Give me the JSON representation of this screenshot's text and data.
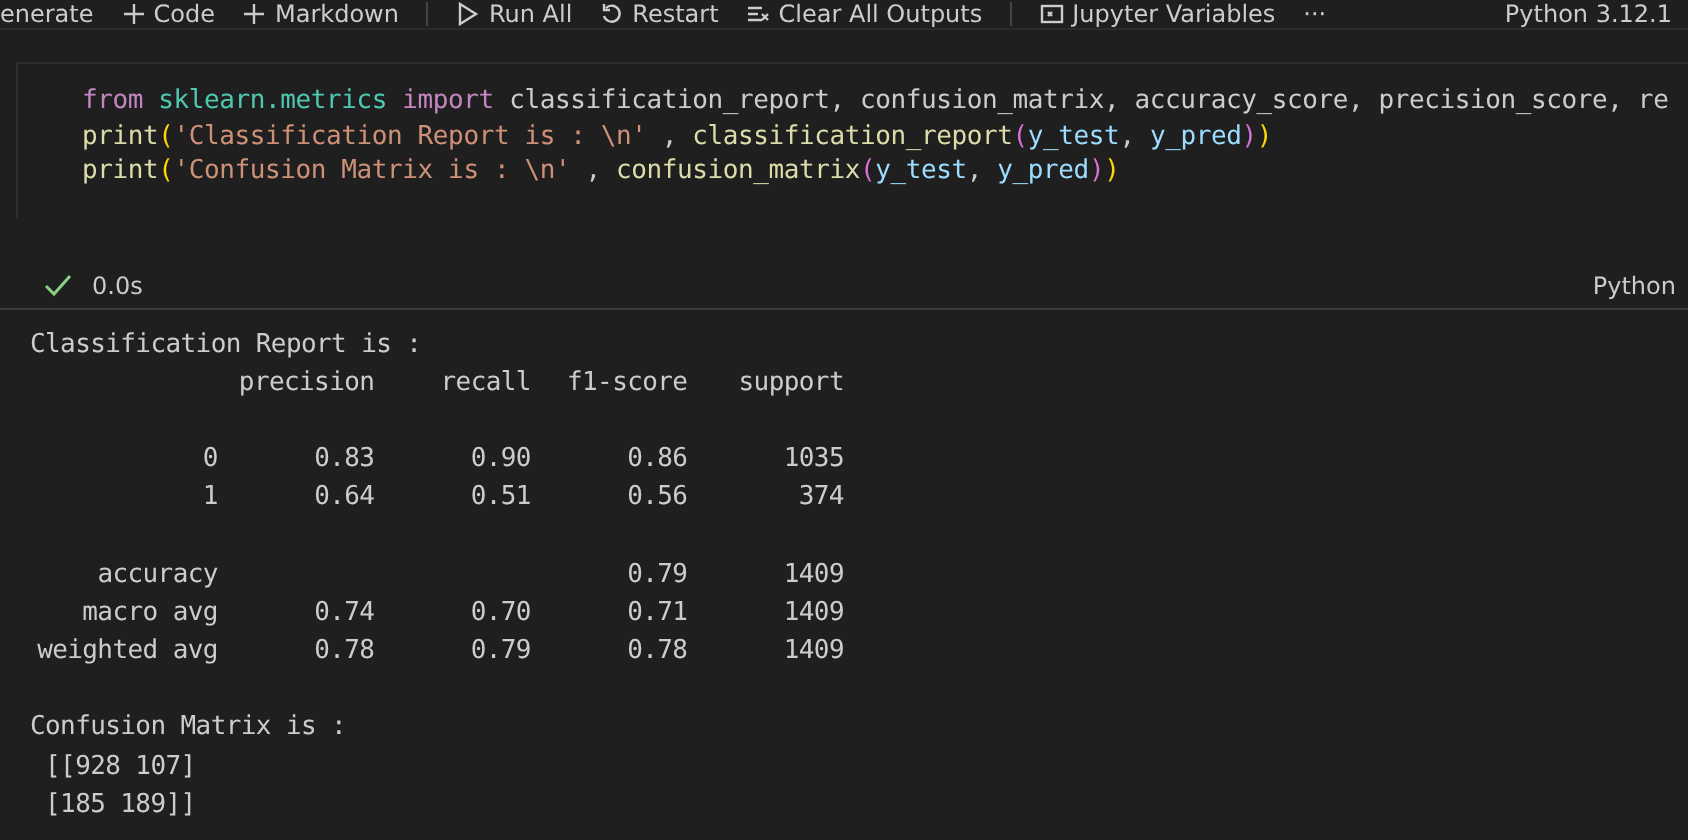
{
  "toolbar": {
    "items": [
      {
        "label": "enerate",
        "kind": "text"
      },
      {
        "label": "Code",
        "kind": "plus"
      },
      {
        "label": "Markdown",
        "kind": "plus"
      },
      {
        "label": "Run All",
        "kind": "run"
      },
      {
        "label": "Restart",
        "kind": "restart"
      },
      {
        "label": "Clear All Outputs",
        "kind": "clear"
      },
      {
        "label": "Jupyter Variables",
        "kind": "variables"
      },
      {
        "label": "···",
        "kind": "text"
      }
    ],
    "kernel": "Python 3.12.1"
  },
  "cell": {
    "code_lines": [
      [
        {
          "kind": "keyword",
          "text": "from "
        },
        {
          "kind": "module",
          "text": "sklearn.metrics "
        },
        {
          "kind": "keyword",
          "text": "import"
        },
        {
          "kind": "plain",
          "text": " classification_report, confusion_matrix, accuracy_score, precision_score, re"
        }
      ],
      [
        {
          "kind": "function",
          "text": "print"
        },
        {
          "kind": "paren",
          "text": "("
        },
        {
          "kind": "string",
          "text": "'Classification Report is : \\n'"
        },
        {
          "kind": "plain",
          "text": " , "
        },
        {
          "kind": "function",
          "text": "classification_report"
        },
        {
          "kind": "paren2",
          "text": "("
        },
        {
          "kind": "variable",
          "text": "y_test"
        },
        {
          "kind": "plain",
          "text": ", "
        },
        {
          "kind": "variable",
          "text": "y_pred"
        },
        {
          "kind": "paren2",
          "text": ")"
        },
        {
          "kind": "paren",
          "text": ")"
        }
      ],
      [
        {
          "kind": "function",
          "text": "print"
        },
        {
          "kind": "paren",
          "text": "("
        },
        {
          "kind": "string",
          "text": "'Confusion Matrix is : \\n'"
        },
        {
          "kind": "plain",
          "text": " , "
        },
        {
          "kind": "function",
          "text": "confusion_matrix"
        },
        {
          "kind": "paren2",
          "text": "("
        },
        {
          "kind": "variable",
          "text": "y_test"
        },
        {
          "kind": "plain",
          "text": ", "
        },
        {
          "kind": "variable",
          "text": "y_pred"
        },
        {
          "kind": "paren2",
          "text": ")"
        },
        {
          "kind": "paren",
          "text": ")"
        }
      ]
    ],
    "status": {
      "succeeded": true,
      "time": "0.0s"
    },
    "language": "Python"
  },
  "output": {
    "report_title": "Classification Report is :",
    "columns": [
      "precision",
      "recall",
      "f1-score",
      "support"
    ],
    "row_groups": [
      [
        {
          "label": "0",
          "precision": "0.83",
          "recall": "0.90",
          "f1_score": "0.86",
          "support": "1035"
        },
        {
          "label": "1",
          "precision": "0.64",
          "recall": "0.51",
          "f1_score": "0.56",
          "support": "374"
        }
      ],
      [
        {
          "label": "accuracy",
          "f1_score": "0.79",
          "support": "1409"
        },
        {
          "label": "macro avg",
          "precision": "0.74",
          "recall": "0.70",
          "f1_score": "0.71",
          "support": "1409"
        },
        {
          "label": "weighted avg",
          "precision": "0.78",
          "recall": "0.79",
          "f1_score": "0.78",
          "support": "1409"
        }
      ]
    ],
    "matrix_title": "Confusion Matrix is :",
    "matrix_lines": [
      "[[928 107]",
      "[185 189]]"
    ]
  }
}
